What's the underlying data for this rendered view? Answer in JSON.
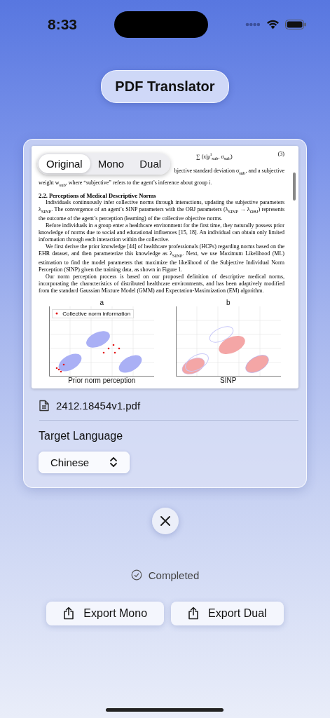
{
  "status_bar": {
    "time": "8:33"
  },
  "title": "PDF Translator",
  "view_modes": [
    {
      "label": "Original",
      "selected": true
    },
    {
      "label": "Mono",
      "selected": false
    },
    {
      "label": "Dual",
      "selected": false
    }
  ],
  "document": {
    "equation": "∑ (x|μ$^{i}$$_{sub}$, σ$_{sub}$)",
    "equation_number": "(3)",
    "covered_line": "bjective standard deviation σ$_{sub}$, and a subjective",
    "next_line": "weight w$_{sub}$, where “subjective” refers to the agent’s inference about group *i*.",
    "heading": "2.2. Perceptions of Medical Descriptive Norms",
    "paragraphs": [
      "Individuals continuously infer collective norms through interactions, updating the subjective parameters λ$_{SINP}$. The convergence of an agent’s SINP parameters with the OBJ parameters (λ$_{SINP}$ → λ$_{OBJ}$) represents the outcome of the agent’s perception (learning) of the collective objective norms.",
      "Before individuals in a group enter a healthcare environment for the first time, they naturally possess prior knowledge of norms due to social and educational influences [15, 18]. An individual can obtain only limited information through each interaction within the collective.",
      "We first derive the prior knowledge [44] of healthcare professionals (HCPs) regarding norms based on the EHR dataset, and then parameterize this knowledge as λ$_{SINP}$. Next, we use Maximum Likelihood (ML) estimation to find the model parameters that maximize the likelihood of the Subjective Individual Norm Perception (SINP) given the training data, as shown in Figure 1.",
      "Our norm perception process is based on our proposed definition of descriptive medical norms, incorporating the characteristics of distributed healthcare environments, and has been adaptively modified from the standard Gaussian Mixture Model (GMM) and Expectation-Maximization (EM) algorithm."
    ],
    "figures": [
      {
        "kind": "prior",
        "title": "a",
        "xlabel": "Prior norm perception",
        "legend": "Collective norm information"
      },
      {
        "kind": "sinp",
        "title": "b",
        "xlabel": "SINP"
      }
    ]
  },
  "file": {
    "name": "2412.18454v1.pdf"
  },
  "target_language": {
    "label": "Target Language",
    "value": "Chinese"
  },
  "status": {
    "label": "Completed"
  },
  "actions": [
    {
      "label": "Export Mono"
    },
    {
      "label": "Export Dual"
    }
  ]
}
